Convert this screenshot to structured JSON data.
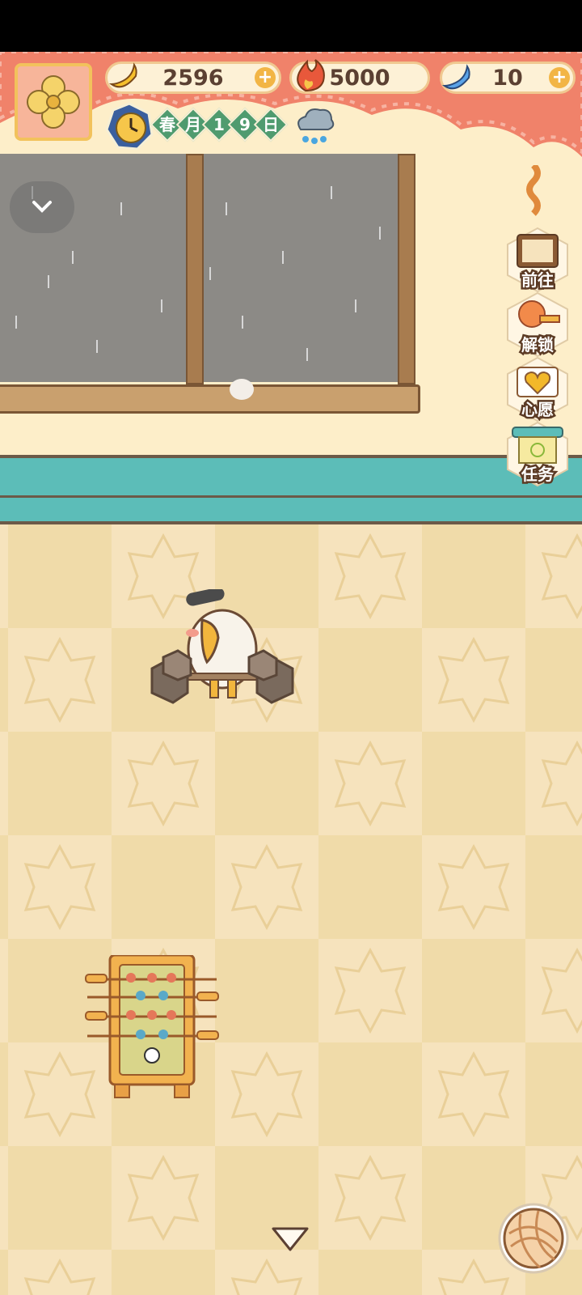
{
  "resources": {
    "banana": {
      "value": "2596",
      "icon": "banana-icon",
      "has_plus": true
    },
    "flame": {
      "value": "5000",
      "icon": "flame-icon",
      "has_plus": false
    },
    "blue_banana": {
      "value": "10",
      "icon": "blue-banana-icon",
      "has_plus": true
    },
    "plus_label": "+"
  },
  "date": {
    "clock_icon": "clock-icon",
    "chars": [
      "春",
      "月",
      "1",
      "9",
      "日"
    ],
    "weather_icon": "rain-cloud-icon"
  },
  "side_menu": [
    {
      "label": "前往",
      "icon": "notice-board-icon"
    },
    {
      "label": "解锁",
      "icon": "key-icon"
    },
    {
      "label": "心愿",
      "icon": "heart-book-icon"
    },
    {
      "label": "任务",
      "icon": "task-scroll-icon"
    }
  ],
  "colors": {
    "curtain": "#f0826a",
    "wainscot": "#5cbdb8",
    "floor_light": "#f6e3bd",
    "floor_dark": "#eed7a8"
  },
  "scene": {
    "character": "eagle-weightlifter",
    "furniture": "foosball-table"
  }
}
